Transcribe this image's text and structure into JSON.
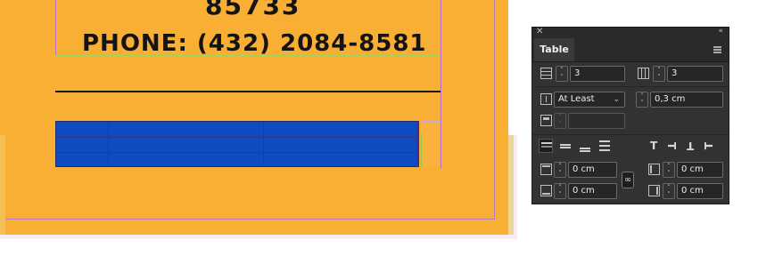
{
  "document": {
    "zip_text": "85733",
    "phone_text": "PHONE: (432) 2084-8581",
    "page_color": "#f9ae34",
    "table_fill_color": "#0f4cc2"
  },
  "panel": {
    "tab_label": "Table",
    "close_icon": "close-icon",
    "collapse_icon": "double-chevron-icon",
    "rows_value": "3",
    "columns_value": "3",
    "row_height_mode": "At Least",
    "row_height_value": "0,3 cm",
    "max_height_value": "",
    "inset_top": "0 cm",
    "inset_left": "0 cm",
    "inset_bottom": "0 cm",
    "inset_right": "0 cm"
  }
}
